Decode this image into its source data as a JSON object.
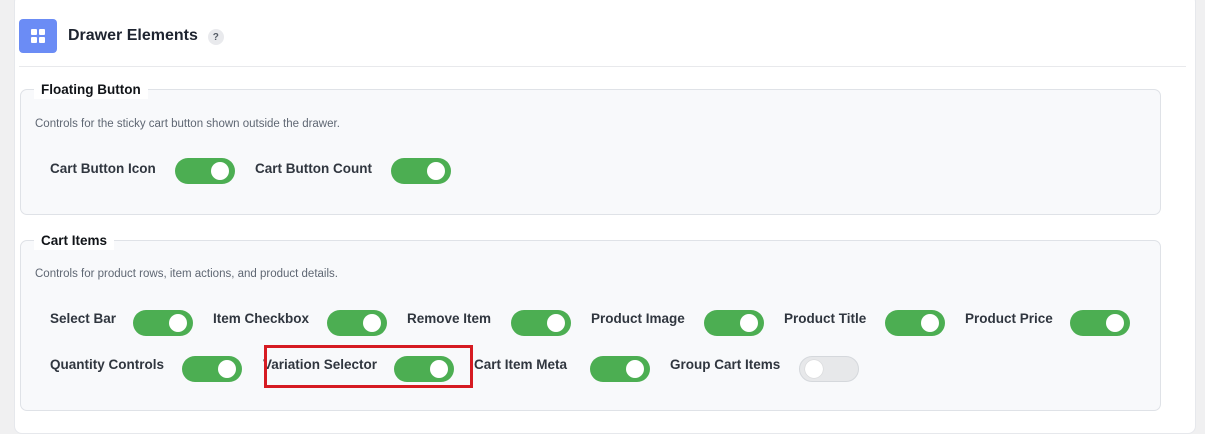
{
  "header": {
    "title": "Drawer Elements",
    "help": "?",
    "icon": "grid-icon",
    "accent_color": "#6b8cf5"
  },
  "sections": {
    "floating": {
      "legend": "Floating Button",
      "description": "Controls for the sticky cart button shown outside the drawer.",
      "toggles": [
        {
          "label": "Cart Button Icon",
          "on": true
        },
        {
          "label": "Cart Button Count",
          "on": true
        }
      ]
    },
    "cart_items": {
      "legend": "Cart Items",
      "description": "Controls for product rows, item actions, and product details.",
      "toggles": [
        {
          "label": "Select Bar",
          "on": true
        },
        {
          "label": "Item Checkbox",
          "on": true
        },
        {
          "label": "Remove Item",
          "on": true
        },
        {
          "label": "Product Image",
          "on": true
        },
        {
          "label": "Product Title",
          "on": true
        },
        {
          "label": "Product Price",
          "on": true
        },
        {
          "label": "Quantity Controls",
          "on": true
        },
        {
          "label": "Variation Selector",
          "on": true
        },
        {
          "label": "Cart Item Meta",
          "on": true
        },
        {
          "label": "Group Cart Items",
          "on": false
        }
      ]
    }
  },
  "colors": {
    "toggle_on": "#4cae52",
    "toggle_off": "#e7e8ea",
    "highlight": "#d61b22"
  }
}
